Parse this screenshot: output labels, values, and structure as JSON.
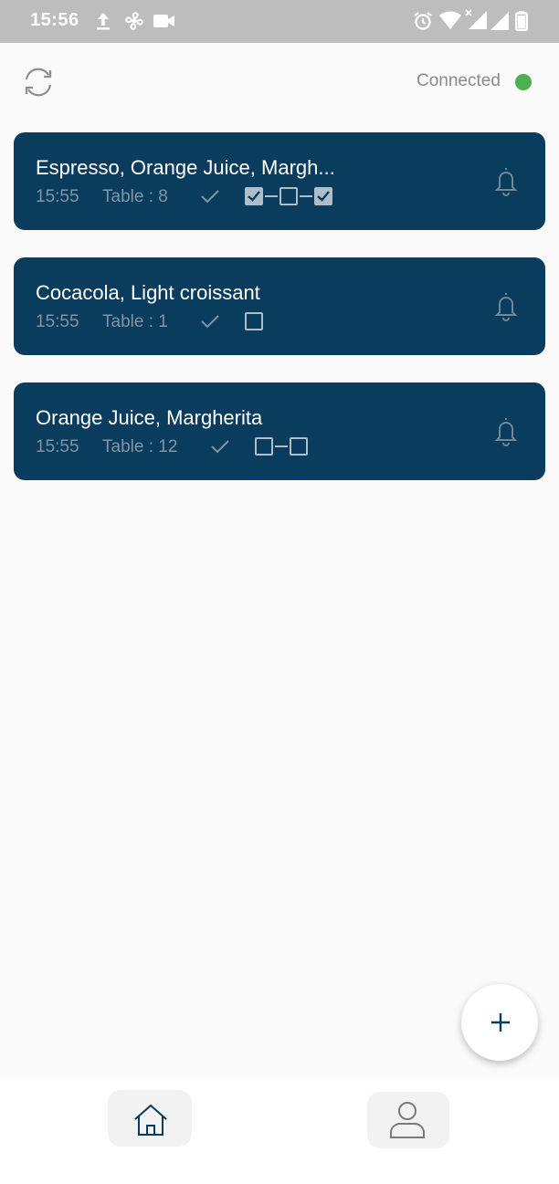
{
  "status_bar": {
    "time": "15:56",
    "left_icons": [
      "upload-icon",
      "fan-icon",
      "video-camera-icon"
    ],
    "right_icons": [
      "alarm-icon",
      "wifi-icon",
      "signal-icon",
      "signal-icon",
      "battery-icon"
    ]
  },
  "header": {
    "refresh_icon": "refresh-icon",
    "connection_label": "Connected",
    "connection_color": "#4caf50"
  },
  "orders": [
    {
      "title": "Espresso, Orange Juice, Margh...",
      "time": "15:55",
      "table": "Table : 8",
      "items_checked": [
        true,
        false,
        true
      ]
    },
    {
      "title": "Cocacola, Light croissant",
      "time": "15:55",
      "table": "Table : 1",
      "items_checked": [
        false
      ]
    },
    {
      "title": "Orange Juice, Margherita",
      "time": "15:55",
      "table": "Table : 12",
      "items_checked": [
        false,
        false
      ]
    }
  ],
  "fab": {
    "icon": "plus-icon"
  },
  "bottom_nav": [
    {
      "icon": "home-icon",
      "selected": true
    },
    {
      "icon": "user-icon",
      "selected": false
    }
  ],
  "colors": {
    "card_bg": "#0a3c5e",
    "page_bg": "#fafafa",
    "status_bar_bg": "#bdbdbd"
  }
}
